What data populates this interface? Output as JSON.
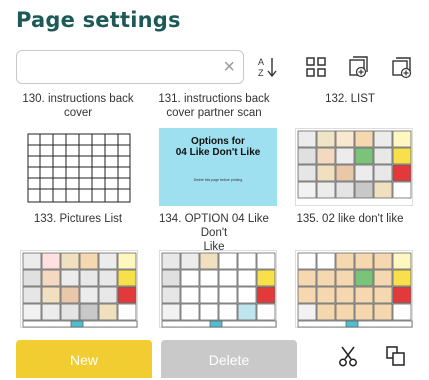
{
  "page": {
    "title": "Page settings"
  },
  "search": {
    "value": "",
    "placeholder": "",
    "clear_glyph": "×"
  },
  "toolbar": {
    "icons": [
      "sort-az-icon",
      "grid-view-icon",
      "add-page-icon",
      "add-pages-icon"
    ]
  },
  "grid": {
    "top_row_captions": [
      {
        "line1": "130. instructions back",
        "line2": "cover"
      },
      {
        "line1": "131. instructions back",
        "line2": "cover partner scan"
      },
      {
        "line1": "132. LIST",
        "line2": ""
      }
    ],
    "items": [
      {
        "caption1": "133. Pictures List",
        "caption2": ""
      },
      {
        "caption1": "134. OPTION 04 Like Don't",
        "caption2": "Like",
        "thumb_title1": "Options for",
        "thumb_title2": "04 Like Don't Like",
        "thumb_note": "Delete this page before printing",
        "thumb_bg": "#9ee0f0"
      },
      {
        "caption1": "135. 02 like don't like",
        "caption2": ""
      }
    ]
  },
  "bottom": {
    "new_label": "New",
    "delete_label": "Delete",
    "icons": [
      "cut-icon",
      "copy-icon"
    ]
  },
  "colors": {
    "title": "#1d5a57",
    "new_button": "#f2cd32",
    "delete_button": "#c9c9c9"
  }
}
